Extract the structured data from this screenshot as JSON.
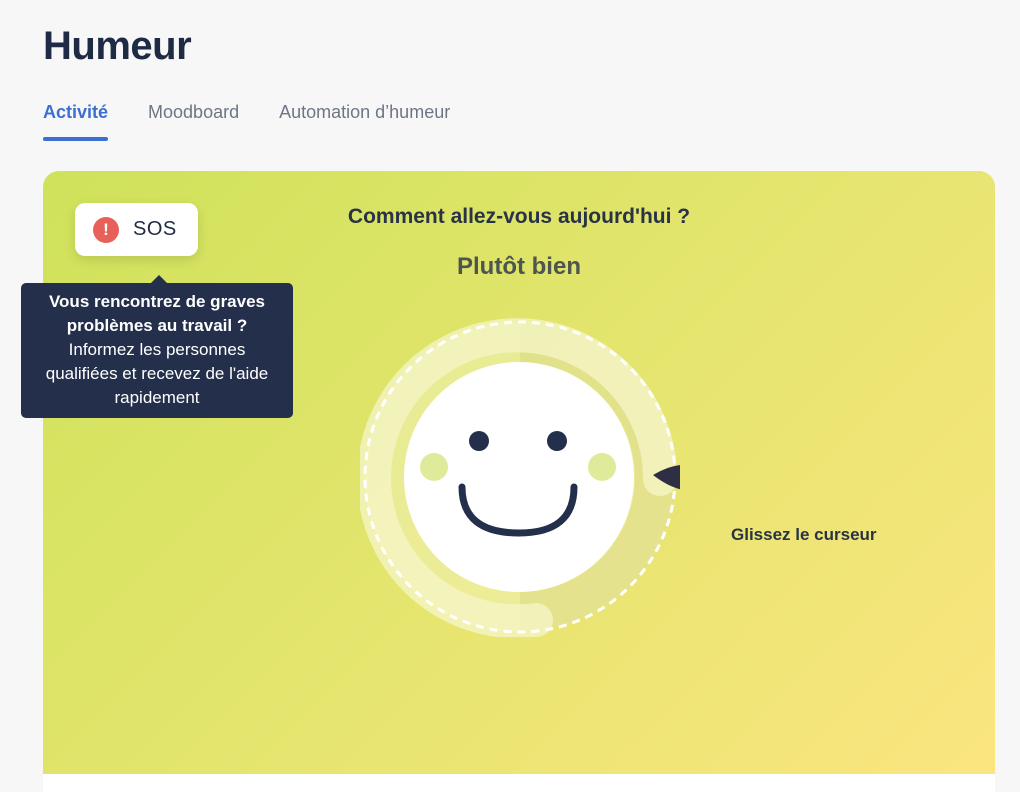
{
  "page": {
    "title": "Humeur"
  },
  "tabs": [
    {
      "label": "Activité",
      "active": true
    },
    {
      "label": "Moodboard",
      "active": false
    },
    {
      "label": "Automation d’humeur",
      "active": false
    }
  ],
  "mood_card": {
    "sos": {
      "label": "SOS",
      "icon": "exclamation-icon",
      "icon_glyph": "!"
    },
    "tooltip": {
      "title": "Vous rencontrez de graves problèmes au travail ?",
      "body": "Informez les personnes qualifiées et recevez de l'aide rapidement"
    },
    "question": "Comment allez-vous aujourd'hui ?",
    "current_mood": "Plutôt bien",
    "slider_hint": "Glissez le curseur",
    "mood_level": 0.75
  },
  "colors": {
    "accent": "#3b6fd1",
    "title": "#1f2a44",
    "sos_red": "#e8605a",
    "tooltip_bg": "#232f4b",
    "card_gradient_start": "#cfe25a",
    "card_gradient_end": "#fbe57f"
  }
}
